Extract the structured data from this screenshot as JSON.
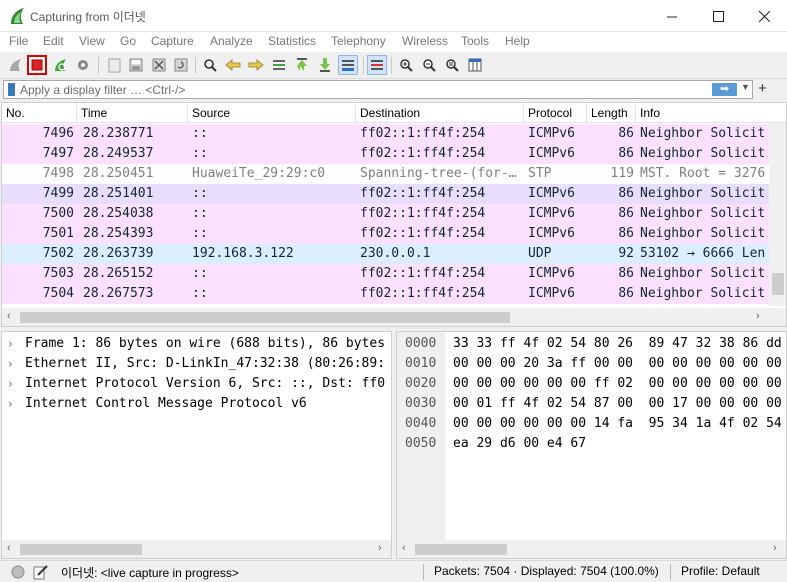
{
  "window": {
    "title": "Capturing from 이더넷"
  },
  "menu": [
    "File",
    "Edit",
    "View",
    "Go",
    "Capture",
    "Analyze",
    "Statistics",
    "Telephony",
    "Wireless",
    "Tools",
    "Help"
  ],
  "filter": {
    "placeholder": "Apply a display filter … <Ctrl-/>",
    "value": ""
  },
  "columns": [
    "No.",
    "Time",
    "Source",
    "Destination",
    "Protocol",
    "Length",
    "Info"
  ],
  "packets": [
    {
      "no": "7496",
      "time": "28.238771",
      "source": "::",
      "destination": "ff02::1:ff4f:254",
      "protocol": "ICMPv6",
      "length": "86",
      "info": "Neighbor Solicit",
      "bg": "#fce0ff",
      "fg": "#12272e"
    },
    {
      "no": "7497",
      "time": "28.249537",
      "source": "::",
      "destination": "ff02::1:ff4f:254",
      "protocol": "ICMPv6",
      "length": "86",
      "info": "Neighbor Solicit",
      "bg": "#fce0ff",
      "fg": "#12272e"
    },
    {
      "no": "7498",
      "time": "28.250451",
      "source": "HuaweiTe_29:29:c0",
      "destination": "Spanning-tree-(for-…",
      "protocol": "STP",
      "length": "119",
      "info": "MST. Root = 3276",
      "bg": "#ffffff",
      "fg": "#7f7f7f"
    },
    {
      "no": "7499",
      "time": "28.251401",
      "source": "::",
      "destination": "ff02::1:ff4f:254",
      "protocol": "ICMPv6",
      "length": "86",
      "info": "Neighbor Solicit",
      "bg": "#e8ddfd",
      "fg": "#12272e"
    },
    {
      "no": "7500",
      "time": "28.254038",
      "source": "::",
      "destination": "ff02::1:ff4f:254",
      "protocol": "ICMPv6",
      "length": "86",
      "info": "Neighbor Solicit",
      "bg": "#fce0ff",
      "fg": "#12272e"
    },
    {
      "no": "7501",
      "time": "28.254393",
      "source": "::",
      "destination": "ff02::1:ff4f:254",
      "protocol": "ICMPv6",
      "length": "86",
      "info": "Neighbor Solicit",
      "bg": "#fce0ff",
      "fg": "#12272e"
    },
    {
      "no": "7502",
      "time": "28.263739",
      "source": "192.168.3.122",
      "destination": "230.0.0.1",
      "protocol": "UDP",
      "length": "92",
      "info": "53102 → 6666 Len",
      "bg": "#daeeff",
      "fg": "#12272e"
    },
    {
      "no": "7503",
      "time": "28.265152",
      "source": "::",
      "destination": "ff02::1:ff4f:254",
      "protocol": "ICMPv6",
      "length": "86",
      "info": "Neighbor Solicit",
      "bg": "#fce0ff",
      "fg": "#12272e"
    },
    {
      "no": "7504",
      "time": "28.267573",
      "source": "::",
      "destination": "ff02::1:ff4f:254",
      "protocol": "ICMPv6",
      "length": "86",
      "info": "Neighbor Solicit",
      "bg": "#fce0ff",
      "fg": "#12272e"
    }
  ],
  "details": [
    "Frame 1: 86 bytes on wire (688 bits), 86 bytes",
    "Ethernet II, Src: D-LinkIn_47:32:38 (80:26:89:",
    "Internet Protocol Version 6, Src: ::, Dst: ff0",
    "Internet Control Message Protocol v6"
  ],
  "hex": [
    {
      "offset": "0000",
      "bytes": "33 33 ff 4f 02 54 80 26  89 47 32 38 86 dd"
    },
    {
      "offset": "0010",
      "bytes": "00 00 00 20 3a ff 00 00  00 00 00 00 00 00"
    },
    {
      "offset": "0020",
      "bytes": "00 00 00 00 00 00 ff 02  00 00 00 00 00 00"
    },
    {
      "offset": "0030",
      "bytes": "00 01 ff 4f 02 54 87 00  00 17 00 00 00 00"
    },
    {
      "offset": "0040",
      "bytes": "00 00 00 00 00 00 14 fa  95 34 1a 4f 02 54"
    },
    {
      "offset": "0050",
      "bytes": "ea 29 d6 00 e4 67"
    }
  ],
  "status": {
    "capture": "이더넷: <live capture in progress>",
    "packets": "Packets: 7504 · Displayed: 7504 (100.0%)",
    "profile": "Profile: Default"
  },
  "colors": {
    "accent": "#3a78c3",
    "stop_border": "#e00000"
  }
}
